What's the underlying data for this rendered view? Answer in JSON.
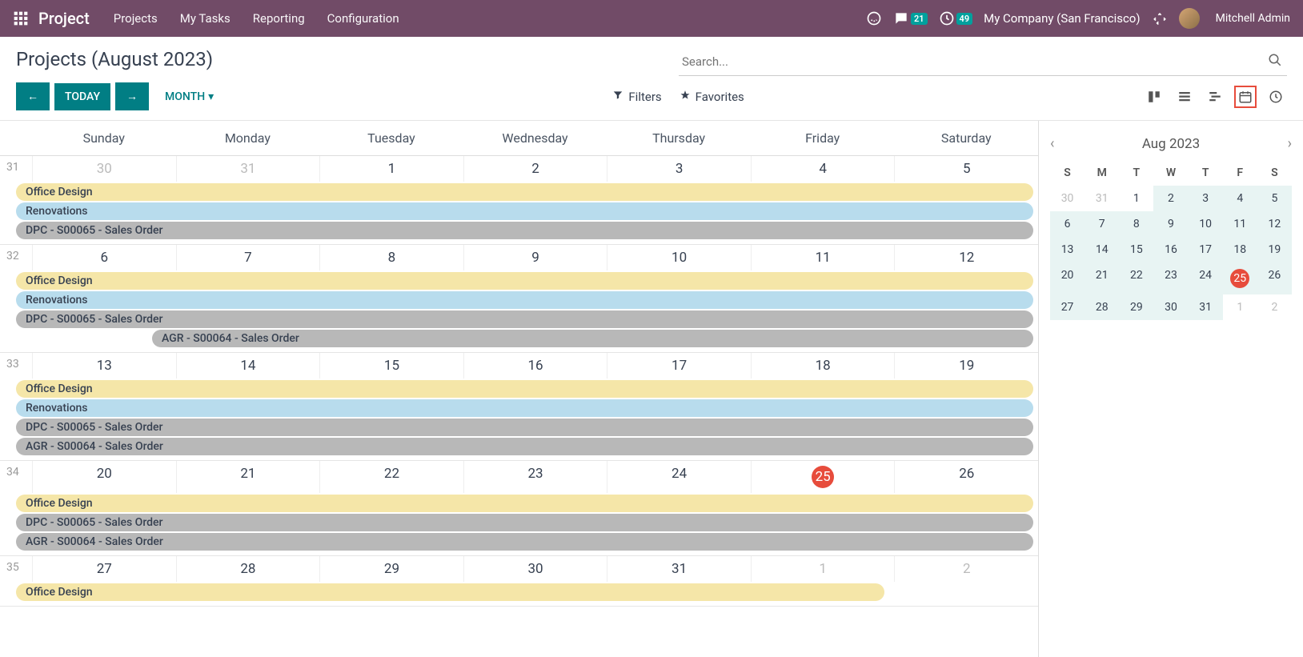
{
  "nav": {
    "brand": "Project",
    "items": [
      "Projects",
      "My Tasks",
      "Reporting",
      "Configuration"
    ],
    "msg_count": "21",
    "activity_count": "49",
    "company": "My Company (San Francisco)",
    "user": "Mitchell Admin"
  },
  "page": {
    "title": "Projects (August 2023)",
    "today_btn": "TODAY",
    "scale": "MONTH",
    "search_placeholder": "Search...",
    "filters_label": "Filters",
    "favorites_label": "Favorites"
  },
  "calendar": {
    "days": [
      "Sunday",
      "Monday",
      "Tuesday",
      "Wednesday",
      "Thursday",
      "Friday",
      "Saturday"
    ],
    "weeks": [
      {
        "num": "31",
        "days": [
          {
            "n": "30",
            "muted": true
          },
          {
            "n": "31",
            "muted": true
          },
          {
            "n": "1"
          },
          {
            "n": "2"
          },
          {
            "n": "3"
          },
          {
            "n": "4"
          },
          {
            "n": "5"
          }
        ],
        "events": [
          {
            "label": "Office Design",
            "cls": "ev-yellow"
          },
          {
            "label": "Renovations",
            "cls": "ev-blue"
          },
          {
            "label": "DPC - S00065 - Sales Order",
            "cls": "ev-gray"
          }
        ]
      },
      {
        "num": "32",
        "days": [
          {
            "n": "6"
          },
          {
            "n": "7"
          },
          {
            "n": "8"
          },
          {
            "n": "9"
          },
          {
            "n": "10"
          },
          {
            "n": "11"
          },
          {
            "n": "12"
          }
        ],
        "events": [
          {
            "label": "Office Design",
            "cls": "ev-yellow"
          },
          {
            "label": "Renovations",
            "cls": "ev-blue"
          },
          {
            "label": "DPC - S00065 - Sales Order",
            "cls": "ev-gray"
          },
          {
            "label": "AGR - S00064 - Sales Order",
            "cls": "ev-gray",
            "offset": true
          }
        ]
      },
      {
        "num": "33",
        "days": [
          {
            "n": "13"
          },
          {
            "n": "14"
          },
          {
            "n": "15"
          },
          {
            "n": "16"
          },
          {
            "n": "17"
          },
          {
            "n": "18"
          },
          {
            "n": "19"
          }
        ],
        "events": [
          {
            "label": "Office Design",
            "cls": "ev-yellow"
          },
          {
            "label": "Renovations",
            "cls": "ev-blue"
          },
          {
            "label": "DPC - S00065 - Sales Order",
            "cls": "ev-gray"
          },
          {
            "label": "AGR - S00064 - Sales Order",
            "cls": "ev-gray"
          }
        ]
      },
      {
        "num": "34",
        "days": [
          {
            "n": "20"
          },
          {
            "n": "21"
          },
          {
            "n": "22"
          },
          {
            "n": "23"
          },
          {
            "n": "24"
          },
          {
            "n": "25",
            "today": true
          },
          {
            "n": "26"
          }
        ],
        "events": [
          {
            "label": "Office Design",
            "cls": "ev-yellow"
          },
          {
            "label": "DPC - S00065 - Sales Order",
            "cls": "ev-gray"
          },
          {
            "label": "AGR - S00064 - Sales Order",
            "cls": "ev-gray"
          }
        ]
      },
      {
        "num": "35",
        "days": [
          {
            "n": "27"
          },
          {
            "n": "28"
          },
          {
            "n": "29"
          },
          {
            "n": "30"
          },
          {
            "n": "31"
          },
          {
            "n": "1",
            "muted": true
          },
          {
            "n": "2",
            "muted": true
          }
        ],
        "events": [
          {
            "label": "Office Design",
            "cls": "ev-yellow",
            "short": true
          }
        ]
      }
    ]
  },
  "mini": {
    "title": "Aug 2023",
    "dow": [
      "S",
      "M",
      "T",
      "W",
      "T",
      "F",
      "S"
    ],
    "rows": [
      [
        {
          "n": "30",
          "muted": true
        },
        {
          "n": "31",
          "muted": true
        },
        {
          "n": "1",
          "sel": true
        },
        {
          "n": "2"
        },
        {
          "n": "3"
        },
        {
          "n": "4"
        },
        {
          "n": "5"
        }
      ],
      [
        {
          "n": "6"
        },
        {
          "n": "7"
        },
        {
          "n": "8"
        },
        {
          "n": "9"
        },
        {
          "n": "10"
        },
        {
          "n": "11"
        },
        {
          "n": "12"
        }
      ],
      [
        {
          "n": "13"
        },
        {
          "n": "14"
        },
        {
          "n": "15"
        },
        {
          "n": "16"
        },
        {
          "n": "17"
        },
        {
          "n": "18"
        },
        {
          "n": "19"
        }
      ],
      [
        {
          "n": "20"
        },
        {
          "n": "21"
        },
        {
          "n": "22"
        },
        {
          "n": "23"
        },
        {
          "n": "24"
        },
        {
          "n": "25",
          "today": true
        },
        {
          "n": "26"
        }
      ],
      [
        {
          "n": "27"
        },
        {
          "n": "28"
        },
        {
          "n": "29"
        },
        {
          "n": "30"
        },
        {
          "n": "31"
        },
        {
          "n": "1",
          "muted": true
        },
        {
          "n": "2",
          "muted": true
        }
      ]
    ]
  }
}
